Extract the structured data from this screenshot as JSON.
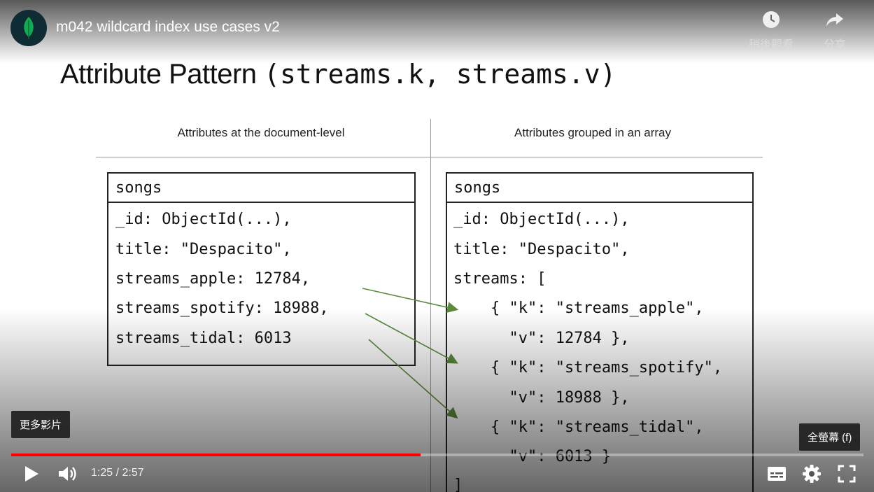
{
  "header": {
    "title": "m042 wildcard index use cases v2",
    "watch_later_label": "稍後觀看",
    "share_label": "分享"
  },
  "slide": {
    "title_text": "Attribute Pattern ",
    "title_code": "(streams.k, streams.v)",
    "left_heading": "Attributes at the document-level",
    "right_heading": "Attributes grouped in an array",
    "left_table": {
      "name": "songs",
      "lines": [
        "_id: ObjectId(...),",
        "title: \"Despacito\",",
        "streams_apple: 12784,",
        "streams_spotify: 18988,",
        "streams_tidal: 6013"
      ]
    },
    "right_table": {
      "name": "songs",
      "lines": [
        "_id: ObjectId(...),",
        "title: \"Despacito\",",
        "streams: [",
        "    { \"k\": \"streams_apple\",",
        "      \"v\": 12784 },",
        "    { \"k\": \"streams_spotify\",",
        "      \"v\": 18988 },",
        "    { \"k\": \"streams_tidal\",",
        "      \"v\": 6013 }",
        "]"
      ]
    },
    "arrow_color": "#5a8a3c"
  },
  "player": {
    "more_videos_tooltip": "更多影片",
    "fullscreen_tooltip": "全螢幕 (f)",
    "time_display": "1:25 / 2:57",
    "progress_fraction": 0.48,
    "progress_color": "#ff0000",
    "icons": [
      "play-icon",
      "volume-icon",
      "subtitles-icon",
      "settings-icon",
      "fullscreen-icon",
      "clock-icon",
      "share-icon",
      "leaf-icon"
    ]
  }
}
